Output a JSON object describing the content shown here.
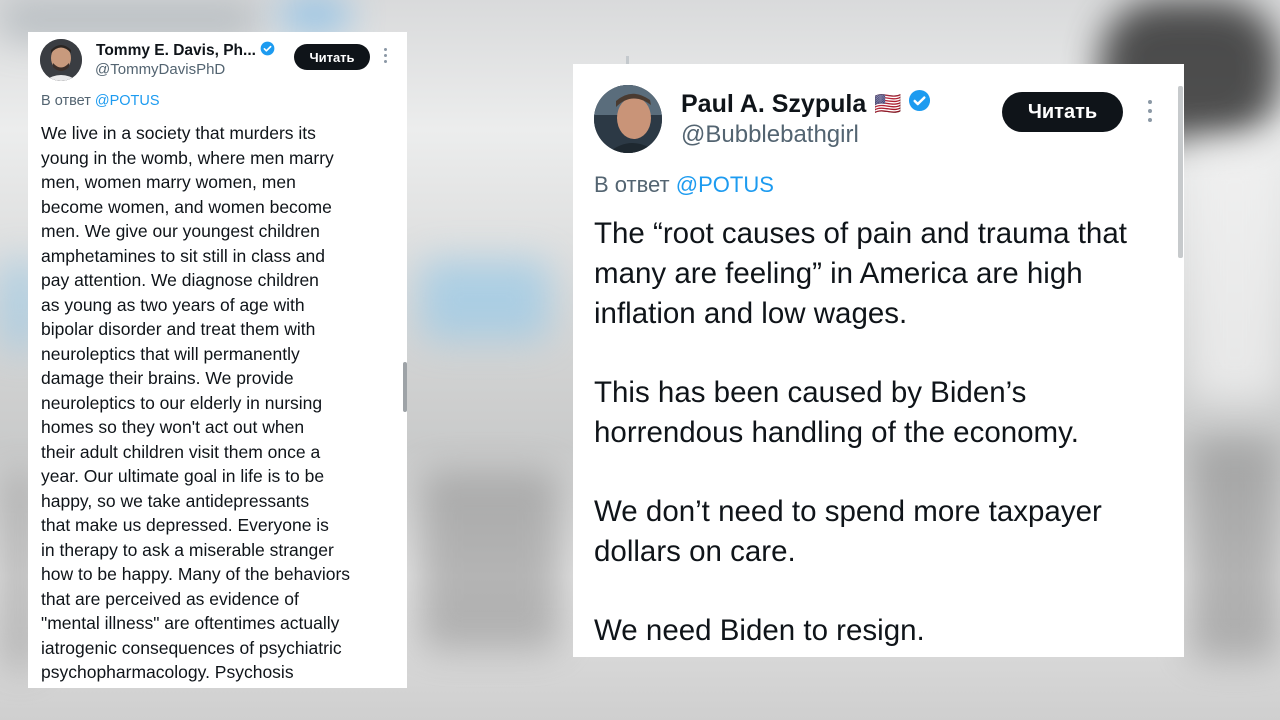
{
  "left_tweet": {
    "author_name": "Tommy E. Davis, Ph...",
    "author_handle": "@TommyDavisPhD",
    "follow_label": "Читать",
    "reply_prefix": "В ответ",
    "reply_mention": "@POTUS",
    "verified": true,
    "body_lines": [
      "We live in a society that murders its",
      "young in the womb, where men marry",
      "men, women marry women, men",
      "become women, and women become",
      "men. We give our youngest children",
      "amphetamines to sit still in class and",
      "pay attention. We diagnose children",
      "as young as two years of age with",
      "bipolar disorder and treat them with",
      "neuroleptics that will permanently",
      "damage their brains. We provide",
      "neuroleptics to our elderly in nursing",
      "homes so they won't act out when",
      "their adult children visit them once a",
      "year. Our ultimate goal in life is to be",
      "happy, so we take antidepressants",
      "that make us depressed. Everyone is",
      "in therapy to ask a miserable stranger",
      "how to be happy. Many of the behaviors",
      "that are perceived as evidence of",
      "\"mental illness\" are oftentimes actually",
      "iatrogenic consequences of psychiatric",
      "psychopharmacology. Psychosis"
    ]
  },
  "right_tweet": {
    "author_name": "Paul A. Szypula",
    "flag_emoji": "🇺🇸",
    "author_handle": "@Bubblebathgirl",
    "follow_label": "Читать",
    "reply_prefix": "В ответ",
    "reply_mention": "@POTUS",
    "verified": true,
    "paragraphs": [
      "The “root causes of pain and trauma that many are feeling” in America are high inflation and low wages.",
      "This has been caused by Biden’s horrendous handling of the economy.",
      "We don’t need to spend more taxpayer dollars on care.",
      "We need Biden to resign."
    ]
  },
  "colors": {
    "text_primary": "#0f1419",
    "text_secondary": "#536471",
    "accent": "#1d9bf0",
    "button_bg": "#0f1419",
    "button_text": "#ffffff"
  },
  "icons": [
    "verified-badge-icon",
    "more-options-icon",
    "avatar"
  ]
}
